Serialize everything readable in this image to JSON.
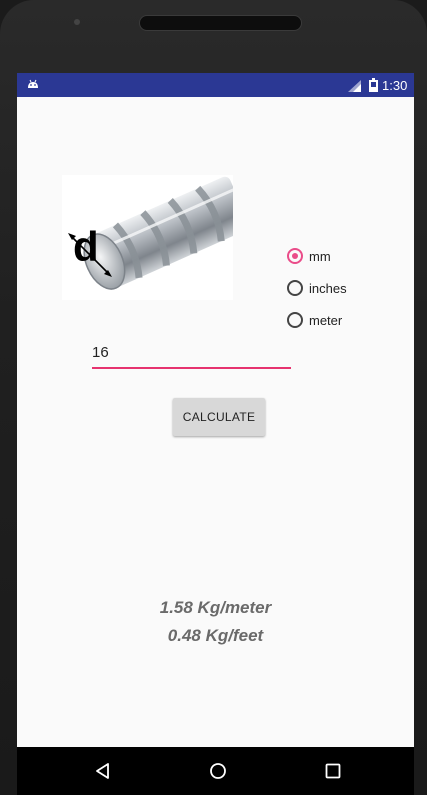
{
  "status_bar": {
    "time": "1:30",
    "icons": [
      "android-notification-icon",
      "signal-icon",
      "battery-icon"
    ]
  },
  "image": {
    "subject": "rebar-diameter-icon",
    "label": "d"
  },
  "units": {
    "options": [
      "mm",
      "inches",
      "meter"
    ],
    "selected": "mm"
  },
  "input": {
    "value": "16"
  },
  "button": {
    "label": "CALCULATE"
  },
  "results": {
    "per_meter": "1.58 Kg/meter",
    "per_feet": "0.48 Kg/feet"
  },
  "nav": {
    "icons": [
      "back-icon",
      "home-icon",
      "recents-icon"
    ]
  },
  "colors": {
    "status_bar": "#2b3894",
    "accent": "#ea4c89",
    "result_text": "#6a6a6a",
    "button_bg": "#d8d8d8",
    "screen_bg": "#fafafa"
  }
}
